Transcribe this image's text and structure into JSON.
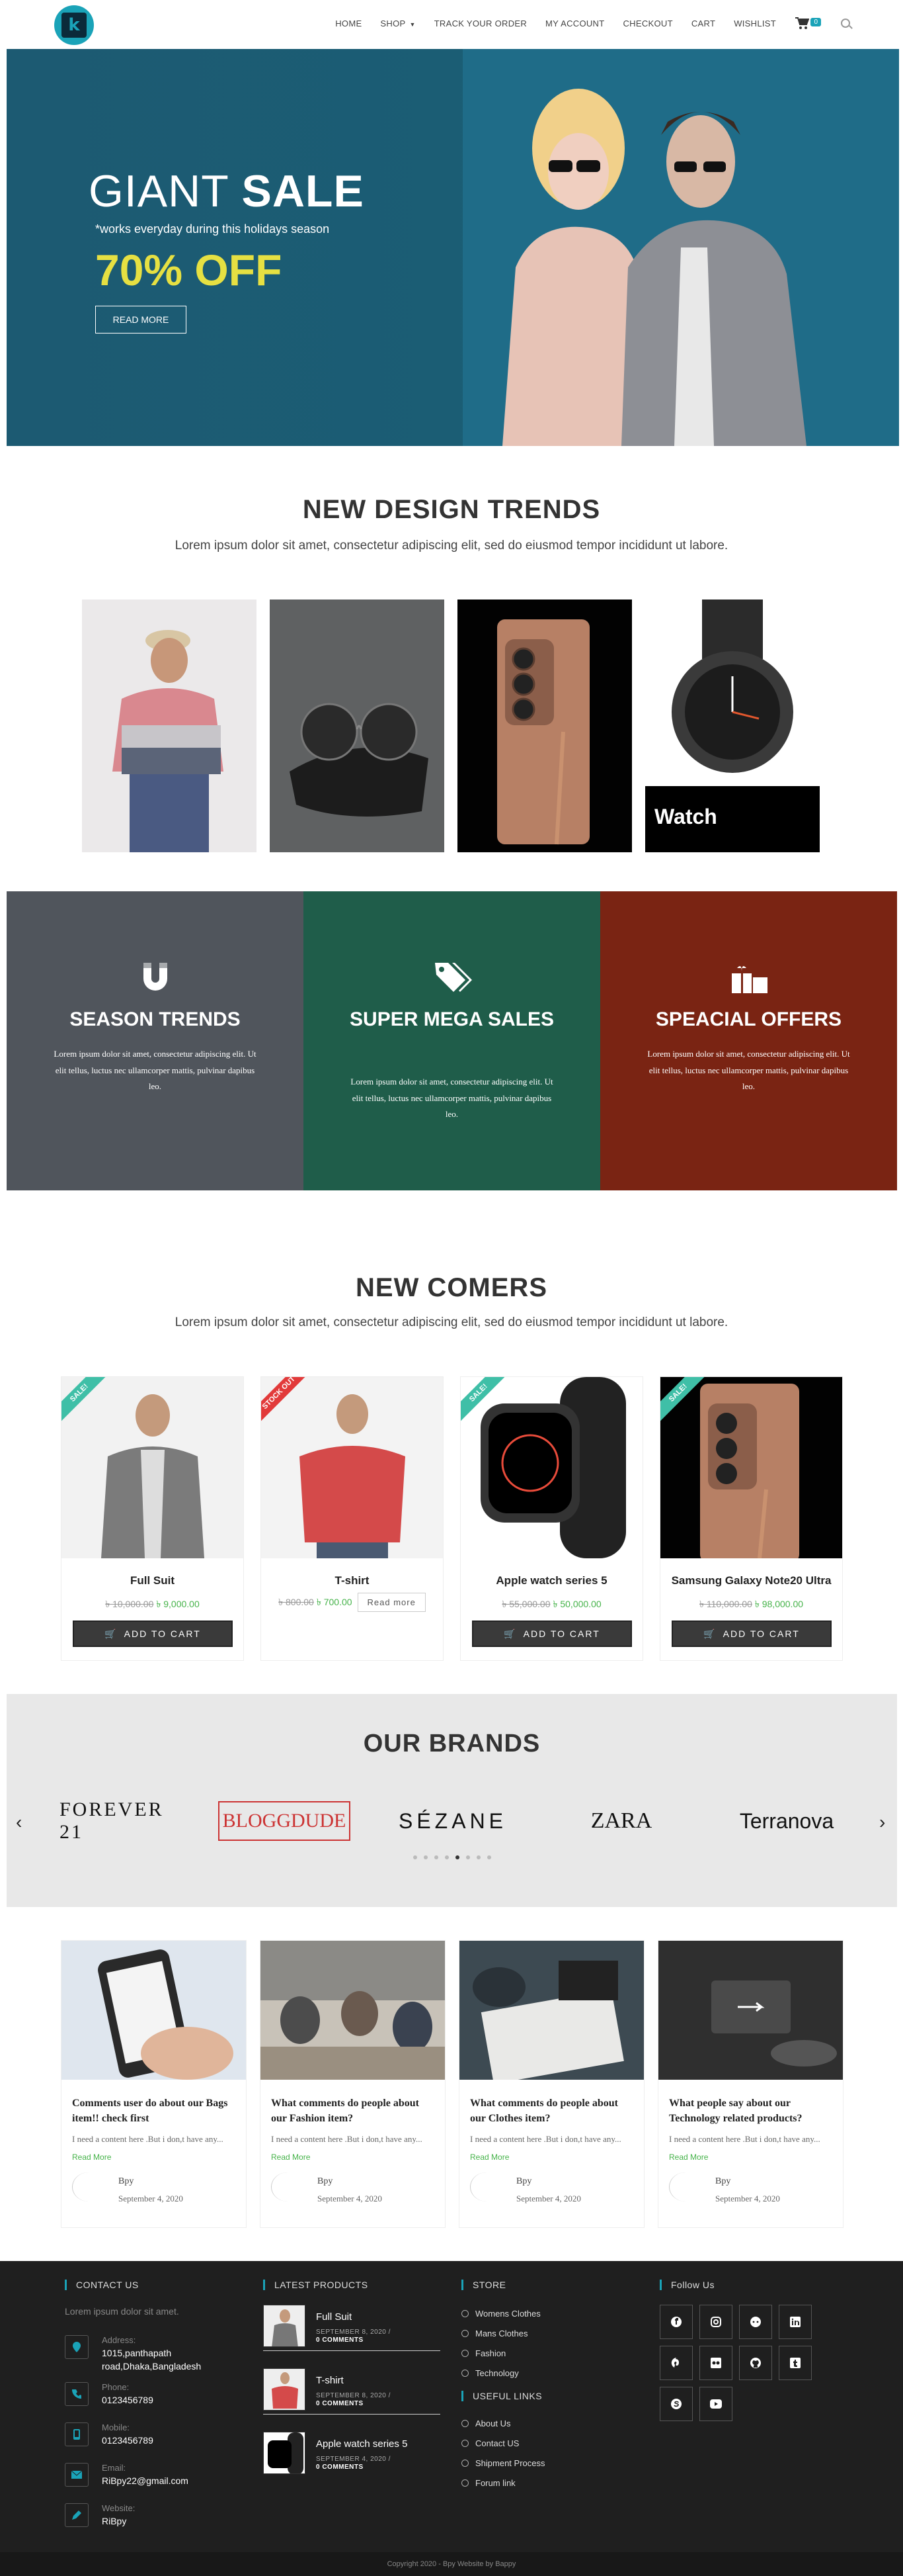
{
  "header": {
    "nav": {
      "home": "HOME",
      "shop": "SHOP",
      "track": "TRACK YOUR ORDER",
      "account": "MY ACCOUNT",
      "checkout": "CHECKOUT",
      "cart": "CART",
      "wishlist": "WISHLIST"
    },
    "cart_count": "0"
  },
  "hero": {
    "title_light": "GIANT",
    "title_bold": "SALE",
    "subtitle": "*works everyday during this holidays season",
    "offer": "70% OFF",
    "button": "READ MORE"
  },
  "trends": {
    "title": "NEW DESIGN TRENDS",
    "subtitle": "Lorem ipsum dolor sit amet, consectetur adipiscing elit, sed do eiusmod tempor incididunt ut labore.",
    "watch_label": "Watch"
  },
  "features": [
    {
      "title": "SEASON TRENDS",
      "text": "Lorem ipsum dolor sit amet, consectetur adipiscing elit. Ut elit tellus, luctus nec ullamcorper mattis, pulvinar dapibus leo.",
      "color": "#50555c",
      "icon": "magnet-icon"
    },
    {
      "title": "SUPER MEGA SALES",
      "text": "Lorem ipsum dolor sit amet, consectetur adipiscing elit. Ut elit tellus, luctus nec ullamcorper mattis, pulvinar dapibus leo.",
      "color": "#1f5d4a",
      "icon": "tags-icon"
    },
    {
      "title": "SPEACIAL OFFERS",
      "text": "Lorem ipsum dolor sit amet, consectetur adipiscing elit. Ut elit tellus, luctus nec ullamcorper mattis, pulvinar dapibus leo.",
      "color": "#7a2413",
      "icon": "gifts-icon"
    }
  ],
  "comers": {
    "title": "NEW COMERS",
    "subtitle": "Lorem ipsum dolor sit amet, consectetur adipiscing elit, sed do eiusmod tempor incididunt ut labore.",
    "products": [
      {
        "name": "Full Suit",
        "old": "৳ 10,000.00",
        "new": "৳ 9,000.00",
        "ribbon": "SALE!",
        "action": "ADD TO CART"
      },
      {
        "name": "T-shirt",
        "old": "৳ 800.00",
        "new": "৳ 700.00",
        "ribbon": "STOCK OUT",
        "action": "Read more"
      },
      {
        "name": "Apple watch series 5",
        "old": "৳ 55,000.00",
        "new": "৳ 50,000.00",
        "ribbon": "SALE!",
        "action": "ADD TO CART"
      },
      {
        "name": "Samsung Galaxy Note20 Ultra",
        "old": "৳ 110,000.00",
        "new": "৳ 98,000.00",
        "ribbon": "SALE!",
        "action": "ADD TO CART"
      }
    ]
  },
  "brands": {
    "title": "OUR BRANDS",
    "items": [
      "FOREVER 21",
      "BLOGGDUDE",
      "SÉZANE",
      "ZARA",
      "Terranova"
    ]
  },
  "blog": [
    {
      "title": "Comments user do about our Bags item!! check first",
      "excerpt": "I need a content here .But i don,t have any...",
      "more": "Read More",
      "author": "Bpy",
      "date": "September 4, 2020"
    },
    {
      "title": "What comments do people about our Fashion item?",
      "excerpt": "I need a content here .But i don,t have any...",
      "more": "Read More",
      "author": "Bpy",
      "date": "September 4, 2020"
    },
    {
      "title": "What comments do people about our Clothes item?",
      "excerpt": "I need a content here .But i don,t have any...",
      "more": "Read More",
      "author": "Bpy",
      "date": "September 4, 2020"
    },
    {
      "title": "What people say about our Technology related products?",
      "excerpt": "I need a content here .But i don,t have any...",
      "more": "Read More",
      "author": "Bpy",
      "date": "September 4, 2020"
    }
  ],
  "footer": {
    "contact_title": "CONTACT US",
    "intro": "Lorem ipsum dolor sit amet.",
    "contacts": [
      {
        "label": "Address:",
        "value": "1015,panthapath road,Dhaka,Bangladesh",
        "icon": "location-icon"
      },
      {
        "label": "Phone:",
        "value": "0123456789",
        "icon": "phone-icon"
      },
      {
        "label": "Mobile:",
        "value": "0123456789",
        "icon": "mobile-icon"
      },
      {
        "label": "Email:",
        "value": "RiBpy22@gmail.com",
        "icon": "email-icon"
      },
      {
        "label": "Website:",
        "value": "RiBpy",
        "icon": "pencil-icon"
      }
    ],
    "latest_title": "LATEST PRODUCTS",
    "latest": [
      {
        "name": "Full Suit",
        "date": "SEPTEMBER 8, 2020 /",
        "comments": "0 COMMENTS"
      },
      {
        "name": "T-shirt",
        "date": "SEPTEMBER 8, 2020 /",
        "comments": "0 COMMENTS"
      },
      {
        "name": "Apple watch series 5",
        "date": "SEPTEMBER 4, 2020 /",
        "comments": "0 COMMENTS"
      }
    ],
    "store_title": "STORE",
    "store": [
      "Womens Clothes",
      "Mans Clothes",
      "Fashion",
      "Technology"
    ],
    "useful_title": "USEFUL LINKS",
    "useful": [
      "About Us",
      "Contact US",
      "Shipment Process",
      "Forum link"
    ],
    "follow_title": "Follow Us",
    "social": [
      "facebook-icon",
      "instagram-icon",
      "reddit-icon",
      "linkedin-icon",
      "pinterest-icon",
      "flickr-icon",
      "github-icon",
      "tumblr-icon",
      "skype-icon",
      "youtube-icon"
    ],
    "copyright": "Copyright 2020 - Bpy Website by Bappy"
  }
}
